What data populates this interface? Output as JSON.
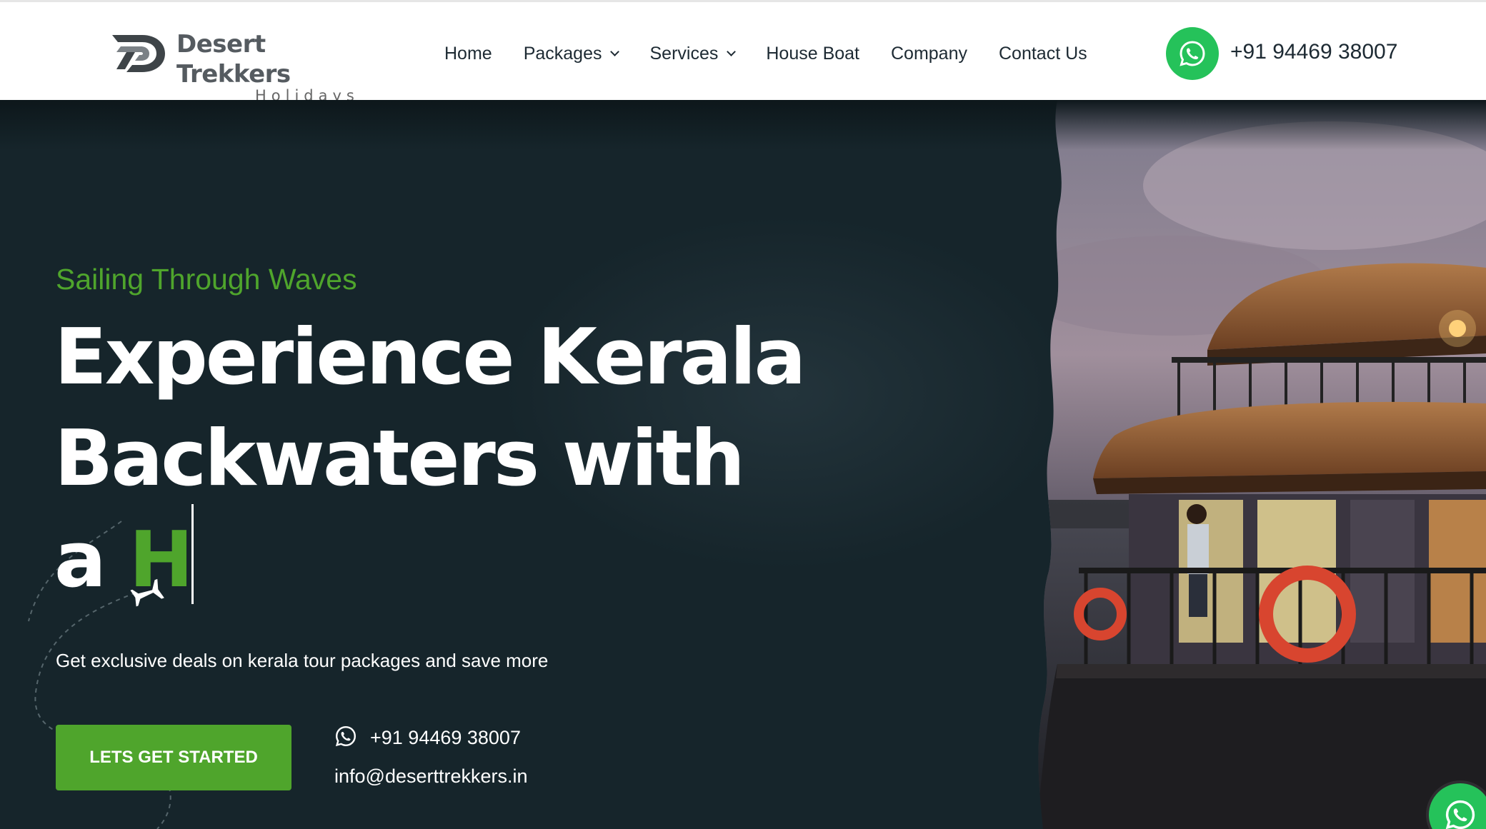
{
  "brand": {
    "name": "Desert Trekkers",
    "sub": "Holidays"
  },
  "nav": {
    "items": [
      {
        "label": "Home",
        "dropdown": false
      },
      {
        "label": "Packages",
        "dropdown": true
      },
      {
        "label": "Services",
        "dropdown": true
      },
      {
        "label": "House Boat",
        "dropdown": false
      },
      {
        "label": "Company",
        "dropdown": false
      },
      {
        "label": "Contact Us",
        "dropdown": false
      }
    ]
  },
  "header": {
    "phone": "+91 94469 38007",
    "whatsapp_icon": "whatsapp-icon"
  },
  "hero": {
    "tagline": "Sailing Through Waves",
    "headline_line1": "Experience Kerala",
    "headline_line2": "Backwaters with",
    "headline_line3_prefix": "a",
    "headline_typed": "H",
    "subtext": "Get exclusive deals on kerala tour packages and save more",
    "cta_label": "LETS GET STARTED",
    "contact_phone": "+91 94469 38007",
    "contact_email": "info@deserttrekkers.in"
  },
  "colors": {
    "accent": "#4fa52c",
    "whatsapp": "#25c25a",
    "hero_bg": "#16252b",
    "nav_text": "#1d2a33"
  }
}
